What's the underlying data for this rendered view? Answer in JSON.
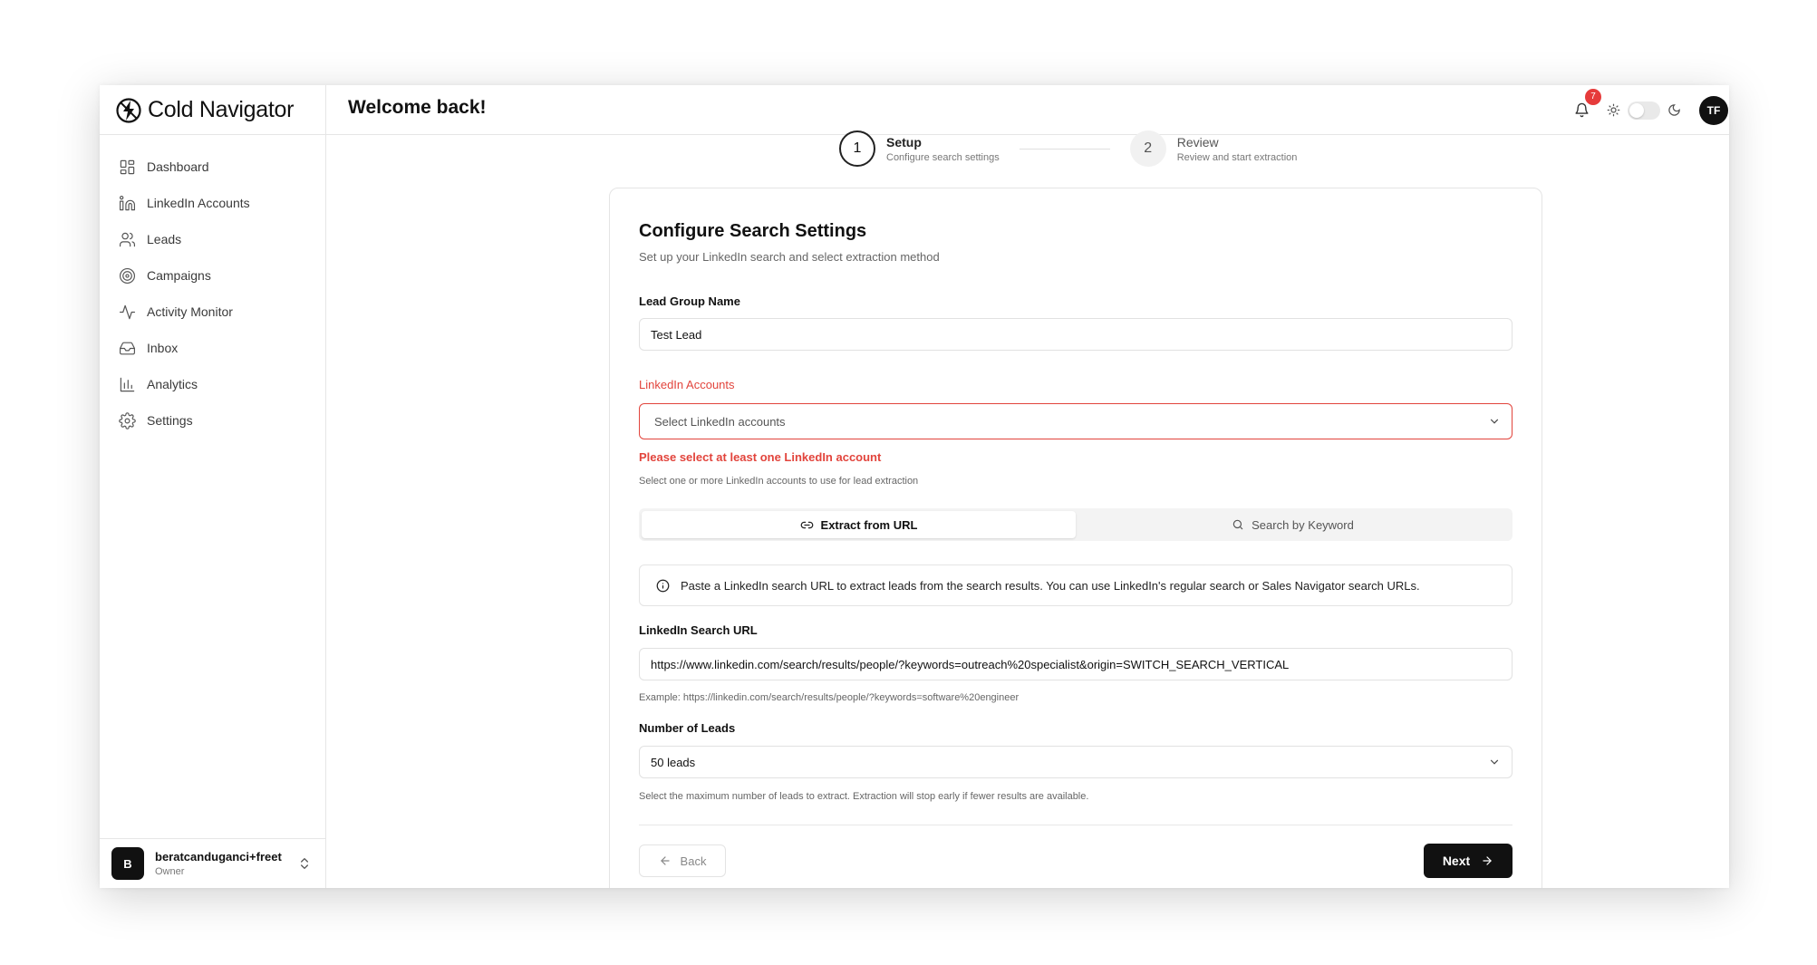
{
  "app": {
    "name": "Cold Navigator",
    "welcome": "Welcome back!"
  },
  "header": {
    "notification_count": "7",
    "user_initials": "TF"
  },
  "sidebar": {
    "items": [
      {
        "label": "Dashboard",
        "icon": "dashboard-icon"
      },
      {
        "label": "LinkedIn Accounts",
        "icon": "linkedin-icon"
      },
      {
        "label": "Leads",
        "icon": "users-icon"
      },
      {
        "label": "Campaigns",
        "icon": "target-icon"
      },
      {
        "label": "Activity Monitor",
        "icon": "activity-icon"
      },
      {
        "label": "Inbox",
        "icon": "inbox-icon"
      },
      {
        "label": "Analytics",
        "icon": "chart-icon"
      },
      {
        "label": "Settings",
        "icon": "gear-icon"
      }
    ],
    "user": {
      "initial": "B",
      "name": "beratcanduganci+freet",
      "role": "Owner"
    }
  },
  "stepper": {
    "steps": [
      {
        "number": "1",
        "title": "Setup",
        "subtitle": "Configure search settings"
      },
      {
        "number": "2",
        "title": "Review",
        "subtitle": "Review and start extraction"
      }
    ]
  },
  "form": {
    "title": "Configure Search Settings",
    "subtitle": "Set up your LinkedIn search and select extraction method",
    "group_name": {
      "label": "Lead Group Name",
      "value": "Test Lead"
    },
    "accounts": {
      "label": "LinkedIn Accounts",
      "placeholder": "Select LinkedIn accounts",
      "error": "Please select at least one LinkedIn account",
      "hint": "Select one or more LinkedIn accounts to use for lead extraction"
    },
    "tabs": {
      "url": "Extract from URL",
      "keyword": "Search by Keyword"
    },
    "info": "Paste a LinkedIn search URL to extract leads from the search results. You can use LinkedIn's regular search or Sales Navigator search URLs.",
    "search_url": {
      "label": "LinkedIn Search URL",
      "value": "https://www.linkedin.com/search/results/people/?keywords=outreach%20specialist&origin=SWITCH_SEARCH_VERTICAL",
      "example": "Example: https://linkedin.com/search/results/people/?keywords=software%20engineer"
    },
    "num_leads": {
      "label": "Number of Leads",
      "value": "50 leads",
      "hint": "Select the maximum number of leads to extract. Extraction will stop early if fewer results are available."
    },
    "buttons": {
      "back": "Back",
      "next": "Next"
    }
  }
}
